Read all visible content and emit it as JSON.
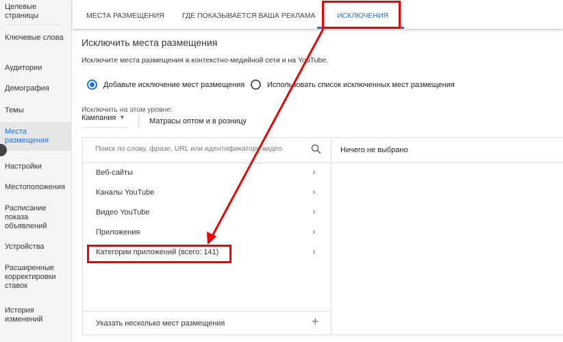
{
  "sidebar": {
    "items": [
      "Целевые страницы",
      "Ключевые слова",
      "Аудитории",
      "Демография",
      "Темы",
      "Места размещения",
      "Настройки",
      "Местоположения",
      "Расписание показа объявлений",
      "Устройства",
      "Расширенные корректировки ставок",
      "История изменений"
    ]
  },
  "tabs": [
    "МЕСТА РАЗМЕЩЕНИЯ",
    "ГДЕ ПОКАЗЫВАЕТСЯ ВАША РЕКЛАМА",
    "ИСКЛЮЧЕНИЯ"
  ],
  "main": {
    "title": "Исключить места размещения",
    "desc": "Исключите места размещения в контекстно-медийной сети и на YouTube.",
    "radio1": "Добавьте исключение мест размещения",
    "radio2": "Использовать список исключенных мест размещения",
    "level_label": "Исключить на этом уровне:",
    "level_value": "Кампания",
    "campaign": "Матрасы оптом и в розницу",
    "search_placeholder": "Поиск по слову, фразе, URL или идентификатору видео",
    "categories": [
      "Веб-сайты",
      "Каналы YouTube",
      "Видео YouTube",
      "Приложения",
      "Категории приложений (всего: 141)"
    ],
    "add_multiple": "Указать несколько мест размещения",
    "right_empty": "Ничего не выбрано"
  },
  "colors": {
    "accent": "#1a73e8",
    "annotation": "#e00000"
  }
}
